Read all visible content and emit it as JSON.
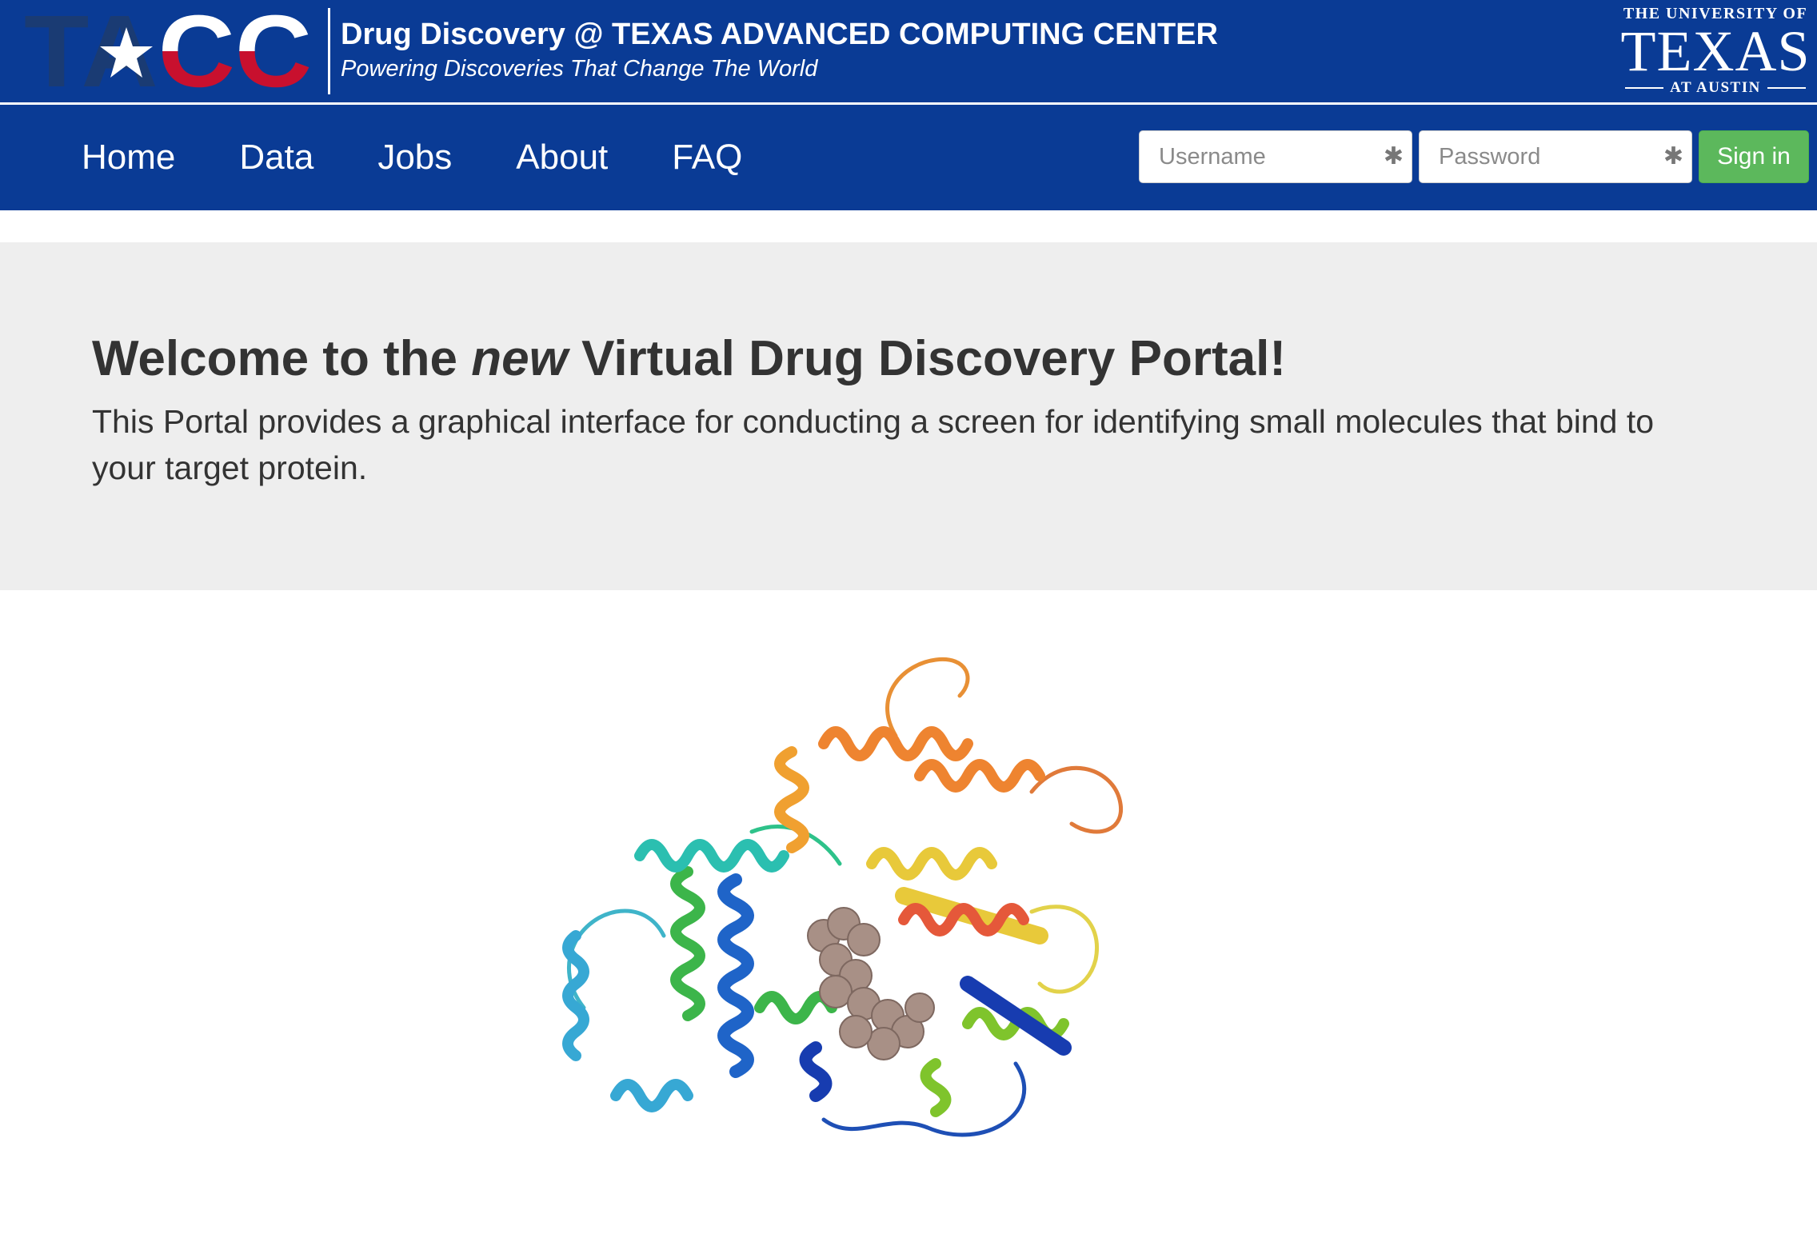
{
  "header": {
    "logo_text": "TACC",
    "site_title": "Drug Discovery @ TEXAS ADVANCED COMPUTING CENTER",
    "tagline": "Powering Discoveries That Change The World",
    "ut_logo": {
      "top": "THE UNIVERSITY OF",
      "main": "TEXAS",
      "bottom": "AT AUSTIN"
    }
  },
  "nav": {
    "items": [
      {
        "label": "Home"
      },
      {
        "label": "Data"
      },
      {
        "label": "Jobs"
      },
      {
        "label": "About"
      },
      {
        "label": "FAQ"
      }
    ]
  },
  "login": {
    "username_placeholder": "Username",
    "password_placeholder": "Password",
    "signin_label": "Sign in"
  },
  "hero": {
    "title_prefix": "Welcome to the ",
    "title_emphasis": "new",
    "title_suffix": " Virtual Drug Discovery Portal!",
    "description": "This Portal provides a graphical interface for conducting a screen for identifying small molecules that bind to your target protein."
  },
  "colors": {
    "brand_blue": "#0a3b95",
    "flag_red": "#c8102e",
    "signin_green": "#5cb85c",
    "jumbotron_bg": "#eeeeee"
  },
  "icons": {
    "required": "asterisk-icon"
  }
}
